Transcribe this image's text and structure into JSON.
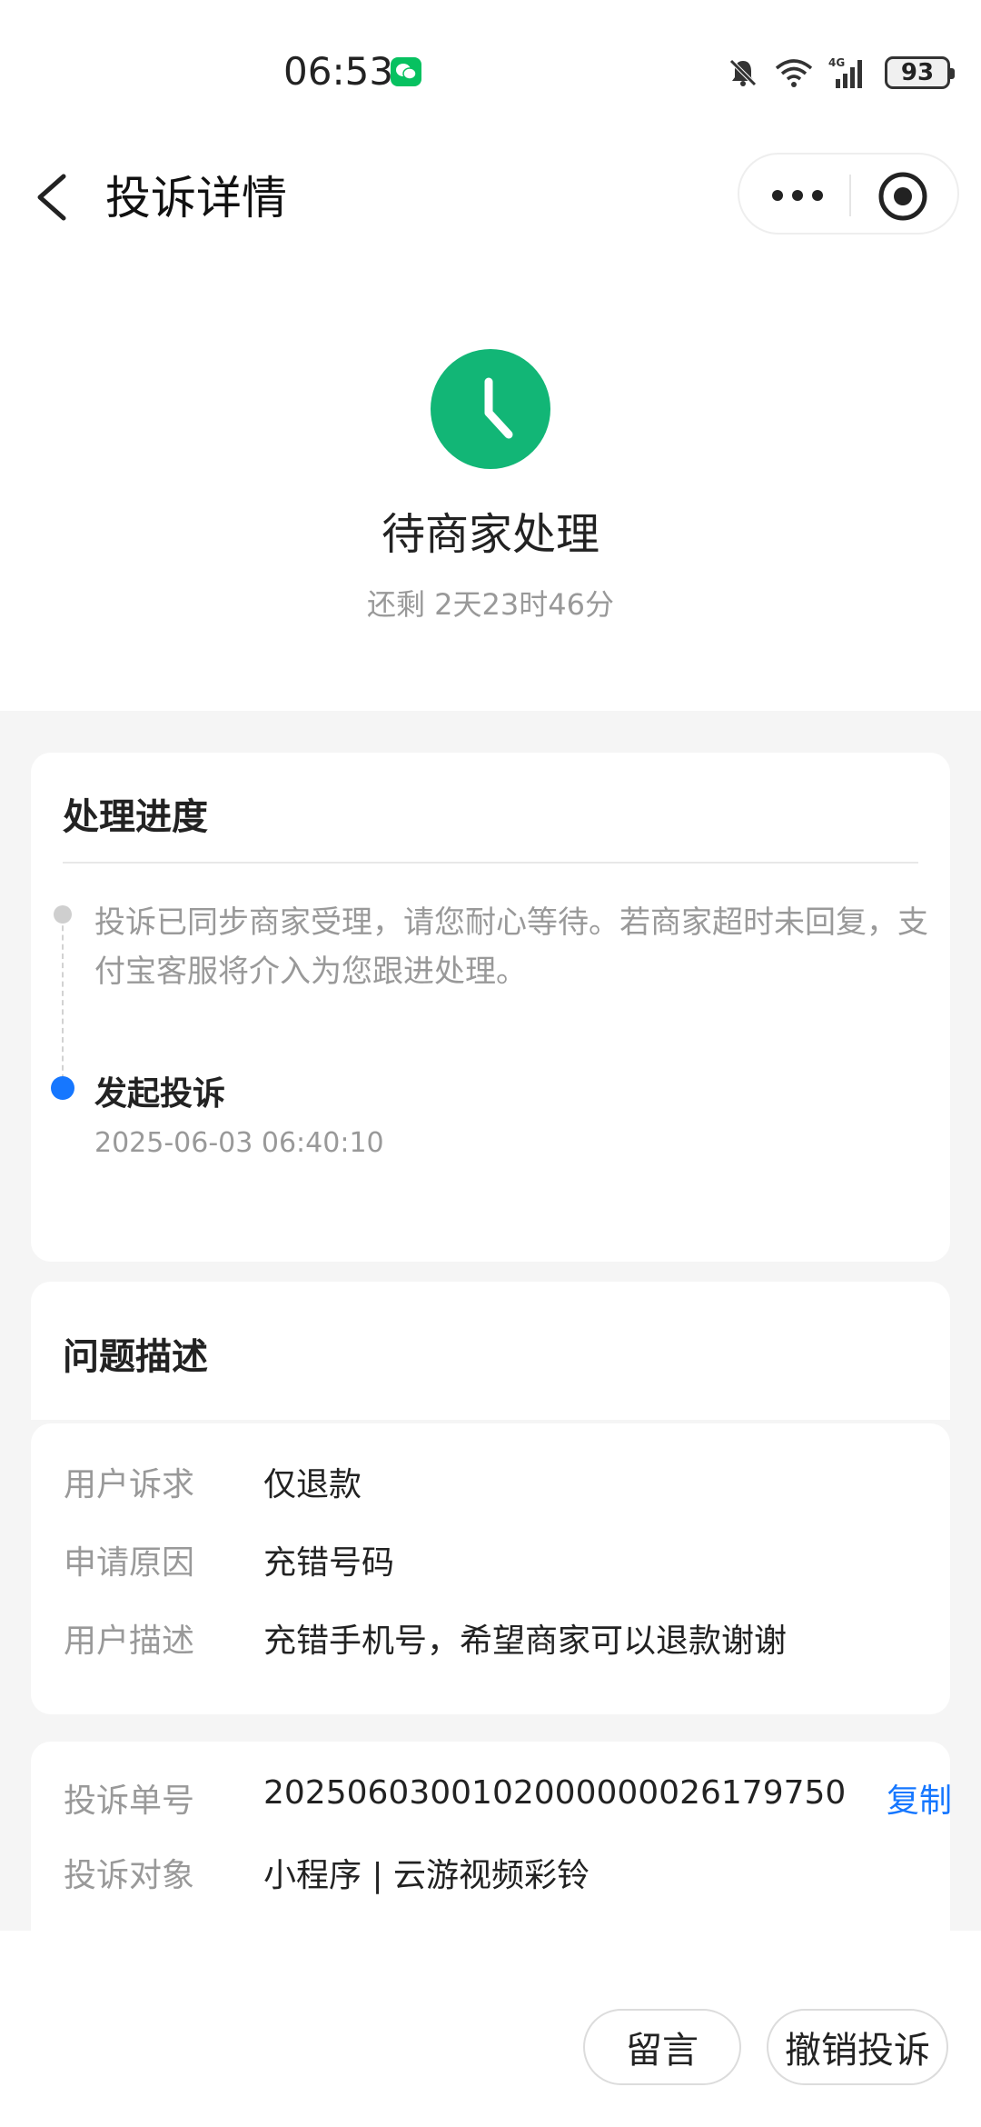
{
  "status_bar": {
    "time": "06:53",
    "battery": "93"
  },
  "nav": {
    "title": "投诉详情"
  },
  "status": {
    "title": "待商家处理",
    "remaining": "还剩 2天23时46分"
  },
  "progress": {
    "title": "处理进度",
    "note": "投诉已同步商家受理，请您耐心等待。若商家超时未回复，支付宝客服将介入为您跟进处理。",
    "event_title": "发起投诉",
    "event_time": "2025-06-03 06:40:10"
  },
  "issue": {
    "title": "问题描述",
    "rows": [
      {
        "label": "用户诉求",
        "value": "仅退款"
      },
      {
        "label": "申请原因",
        "value": "充错号码"
      },
      {
        "label": "用户描述",
        "value": "充错手机号，希望商家可以退款谢谢"
      }
    ]
  },
  "order": {
    "rows": [
      {
        "label": "投诉单号",
        "value": "2025060300102000000026179750",
        "action": "复制"
      },
      {
        "label": "投诉对象",
        "value": "小程序 | 云游视频彩铃"
      }
    ]
  },
  "bottom": {
    "message_label": "留言",
    "cancel_label": "撤销投诉"
  },
  "colors": {
    "accent_green": "#12b676",
    "accent_blue": "#1677ff",
    "wechat_green": "#07c160"
  }
}
